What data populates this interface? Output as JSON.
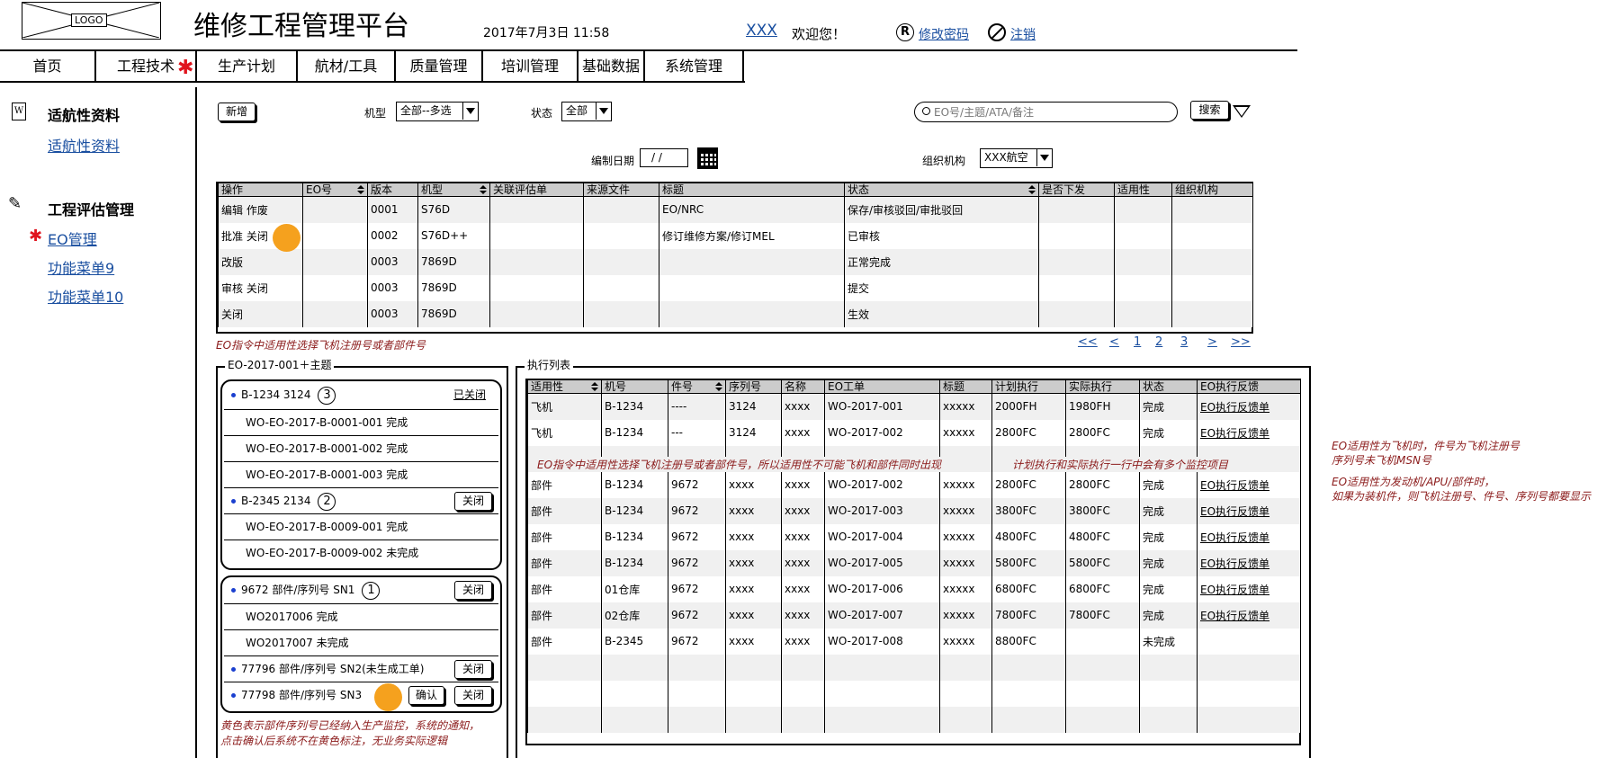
{
  "header": {
    "logo": "LOGO",
    "title": "维修工程管理平台",
    "datetime": "2017年7月3日  11:58",
    "user": "XXX",
    "welcome": "欢迎您！",
    "change_password": "修改密码",
    "logout": "注销"
  },
  "nav": [
    "首页",
    "工程技术",
    "生产计划",
    "航材/工具",
    "质量管理",
    "培训管理",
    "基础数据",
    "系统管理"
  ],
  "sidebar": {
    "groups": [
      {
        "title": "适航性资料",
        "items": [
          "适航性资料"
        ]
      },
      {
        "title": "工程评估管理",
        "items": [
          "EO管理",
          "功能菜单9",
          "功能菜单10"
        ]
      }
    ]
  },
  "toolbar": {
    "new": "新增",
    "aircraft_label": "机型",
    "aircraft_value": "全部--多选",
    "status_label": "状态",
    "status_value": "全部",
    "search_placeholder": "EO号/主题/ATA/备注",
    "search_button": "搜索",
    "date_label": "编制日期",
    "date_value": "/ /",
    "org_label": "组织机构",
    "org_value": "XXX航空"
  },
  "eo_table": {
    "headers": [
      "操作",
      "EO号",
      "版本",
      "机型",
      "关联评估单",
      "来源文件",
      "标题",
      "状态",
      "是否下发",
      "适用性",
      "组织机构"
    ],
    "rows": [
      [
        "编辑  作废",
        "",
        "0001",
        "S76D",
        "",
        "",
        "EO/NRC",
        "保存/审核驳回/审批驳回",
        "",
        "",
        ""
      ],
      [
        "批准 关闭",
        "",
        "0002",
        "S76D++",
        "",
        "",
        "修订维修方案/修订MEL",
        "已审核",
        "",
        "",
        ""
      ],
      [
        "改版",
        "",
        "0003",
        "7869D",
        "",
        "",
        "",
        "正常完成",
        "",
        "",
        ""
      ],
      [
        "审核 关闭",
        "",
        "0003",
        "7869D",
        "",
        "",
        "",
        "提交",
        "",
        "",
        ""
      ],
      [
        "关闭",
        "",
        "0003",
        "7869D",
        "",
        "",
        "",
        "生效",
        "",
        "",
        ""
      ]
    ]
  },
  "notes": {
    "eo_note": "EO指令中适用性选择飞机注册号或者部件号",
    "exec_note1": "EO指令中适用性选择飞机注册号或者部件号，所以适用性不可能飞机和部件同时出现",
    "exec_note2": "计划执行和实际执行一行中会有多个监控项目",
    "yellow_note1": "黄色表示部件序列号已经纳入生产监控，系统的通知，",
    "yellow_note2": "点击确认后系统不在黄色标注，无业务实际逻辑",
    "right_note1": "EO适用性为飞机时，件号为飞机注册号",
    "right_note2": "序列号未飞机MSN号",
    "right_note3": "EO适用性为发动机/APU/部件时，",
    "right_note4": "如果为装机件，则飞机注册号、件号、序列号都要显示"
  },
  "pagination": [
    "<<",
    "<",
    "1",
    "2",
    "3",
    ">",
    ">>"
  ],
  "eo_panel": {
    "title": "EO-2017-001＋主题",
    "groups": [
      {
        "head": "B-1234 3124",
        "num": "3",
        "status": "已关闭",
        "rows": [
          "WO-EO-2017-B-0001-001 完成",
          "WO-EO-2017-B-0001-002 完成",
          "WO-EO-2017-B-0001-003 完成"
        ]
      },
      {
        "head": "B-2345 2134",
        "num": "2",
        "button": "关闭",
        "rows": [
          "WO-EO-2017-B-0009-001 完成",
          "WO-EO-2017-B-0009-002 未完成"
        ]
      },
      {
        "head": "9672 部件/序列号 SN1",
        "num": "1",
        "button": "关闭",
        "rows": [
          "WO2017006 完成",
          "WO2017007 未完成"
        ]
      }
    ],
    "extra": [
      {
        "head": "77796 部件/序列号 SN2(未生成工单)",
        "button": "关闭"
      },
      {
        "head": "77798 部件/序列号 SN3",
        "confirm": "确认",
        "button": "关闭"
      }
    ]
  },
  "exec_table": {
    "title": "执行列表",
    "headers": [
      "适用性",
      "机号",
      "件号",
      "序列号",
      "名称",
      "EO工单",
      "标题",
      "计划执行",
      "实际执行",
      "状态",
      "EO执行反馈"
    ],
    "rows": [
      [
        "飞机",
        "B-1234",
        "----",
        "3124",
        "xxxx",
        "WO-2017-001",
        "xxxxx",
        "2000FH",
        "1980FH",
        "完成",
        "EO执行反馈单"
      ],
      [
        "飞机",
        "B-1234",
        "---",
        "3124",
        "xxxx",
        "WO-2017-002",
        "xxxxx",
        "2800FC",
        "2800FC",
        "完成",
        "EO执行反馈单"
      ],
      [
        "",
        "",
        "",
        "",
        "",
        "",
        "",
        "",
        "",
        "",
        ""
      ],
      [
        "部件",
        "B-1234",
        "9672",
        "xxxx",
        "xxxx",
        "WO-2017-002",
        "xxxxx",
        "2800FC",
        "2800FC",
        "完成",
        "EO执行反馈单"
      ],
      [
        "部件",
        "B-1234",
        "9672",
        "xxxx",
        "xxxx",
        "WO-2017-003",
        "xxxxx",
        "3800FC",
        "3800FC",
        "完成",
        "EO执行反馈单"
      ],
      [
        "部件",
        "B-1234",
        "9672",
        "xxxx",
        "xxxx",
        "WO-2017-004",
        "xxxxx",
        "4800FC",
        "4800FC",
        "完成",
        "EO执行反馈单"
      ],
      [
        "部件",
        "B-1234",
        "9672",
        "xxxx",
        "xxxx",
        "WO-2017-005",
        "xxxxx",
        "5800FC",
        "5800FC",
        "完成",
        "EO执行反馈单"
      ],
      [
        "部件",
        "01仓库",
        "9672",
        "xxxx",
        "xxxx",
        "WO-2017-006",
        "xxxxx",
        "6800FC",
        "6800FC",
        "完成",
        "EO执行反馈单"
      ],
      [
        "部件",
        "02仓库",
        "9672",
        "xxxx",
        "xxxx",
        "WO-2017-007",
        "xxxxx",
        "7800FC",
        "7800FC",
        "完成",
        "EO执行反馈单"
      ],
      [
        "部件",
        "B-2345",
        "9672",
        "xxxx",
        "xxxx",
        "WO-2017-008",
        "xxxxx",
        "8800FC",
        "",
        "未完成",
        ""
      ],
      [
        "",
        "",
        "",
        "",
        "",
        "",
        "",
        "",
        "",
        "",
        ""
      ],
      [
        "",
        "",
        "",
        "",
        "",
        "",
        "",
        "",
        "",
        "",
        ""
      ],
      [
        "",
        "",
        "",
        "",
        "",
        "",
        "",
        "",
        "",
        "",
        ""
      ]
    ]
  },
  "colors": {
    "accent": "#f5a11e",
    "link": "#1a4fa0",
    "note": "#8b1a1a",
    "required": "#e0141e"
  }
}
